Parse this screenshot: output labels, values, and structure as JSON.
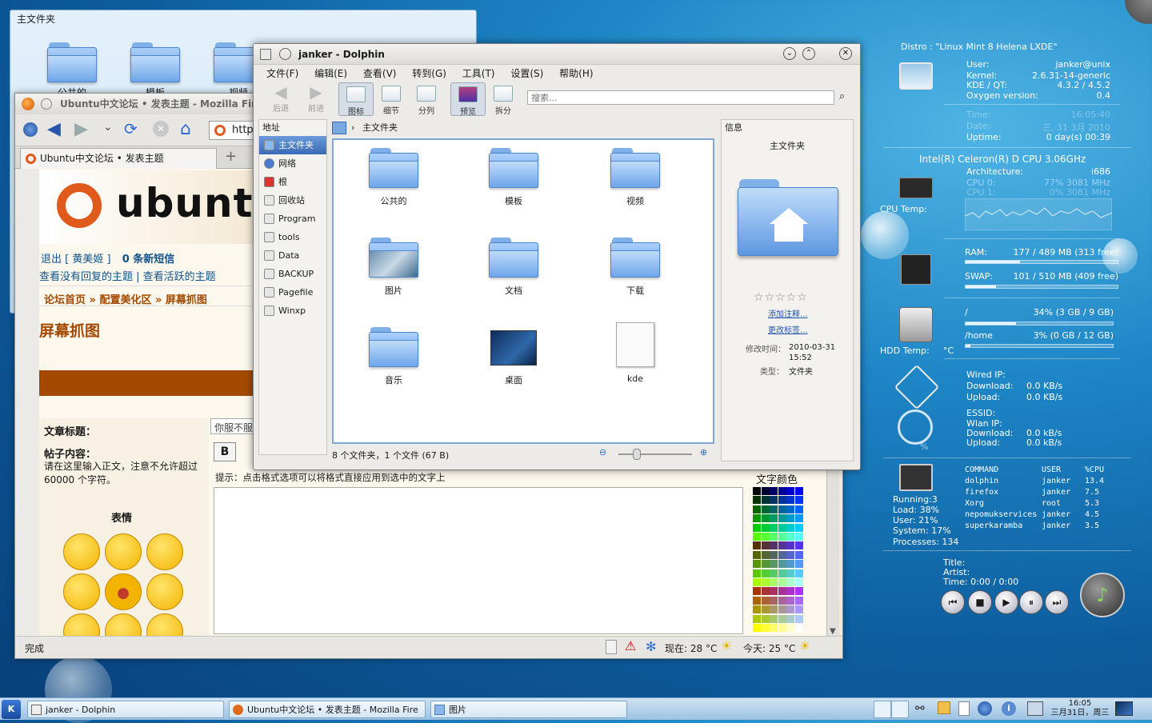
{
  "background_window": {
    "title": "主文件夹",
    "folders": [
      "公共的",
      "模板",
      "视频"
    ]
  },
  "firefox": {
    "title": "Ubuntu中文论坛 • 发表主题 - Mozilla Firefox",
    "url": "http",
    "tab_label": "Ubuntu中文论坛 • 发表主题",
    "logo_text": "ubunt",
    "logout": "退出 [ 黄美姬 ]",
    "messages": "0 条新短信",
    "links": "查看没有回复的主题 | 查看活跃的主题",
    "breadcrumb": "论坛首页 » 配置美化区 » 屏幕抓图",
    "page_heading": "屏幕抓图",
    "subject_label": "文章标题：",
    "subject_value": "你服不服",
    "content_label": "帖子内容：",
    "content_hint": "请在这里输入正文，注意不允许超过 60000 个字符。",
    "bold_btn": "B",
    "format_hint": "提示：点击格式选项可以将格式直接应用到选中的文字上",
    "text_color": "文字颜色",
    "emoticons": "表情",
    "status": "完成",
    "weather_now": "现在: 28 °C",
    "weather_today": "今天: 25 °C"
  },
  "dolphin": {
    "title": "janker - Dolphin",
    "menu": [
      "文件(F)",
      "编辑(E)",
      "查看(V)",
      "转到(G)",
      "工具(T)",
      "设置(S)",
      "帮助(H)"
    ],
    "toolbar": {
      "back": "后退",
      "forward": "前进",
      "icons": "图标",
      "details": "细节",
      "columns": "分列",
      "preview": "预览",
      "split": "拆分"
    },
    "search_placeholder": "搜索...",
    "places_title": "地址",
    "places": [
      "主文件夹",
      "网络",
      "根",
      "回收站",
      "Program",
      "tools",
      "Data",
      "BACKUP",
      "Pagefile",
      "Winxp"
    ],
    "breadcrumb": "主文件夹",
    "files": [
      "公共的",
      "模板",
      "视频",
      "图片",
      "文档",
      "下载",
      "音乐",
      "桌面",
      "kde"
    ],
    "statusbar": "8 个文件夹，1 个文件 (67 B)",
    "info": {
      "title": "信息",
      "name": "主文件夹",
      "add_comment": "添加注释...",
      "change_tags": "更改标签...",
      "modified_label": "修改时间：",
      "modified_value": "2010-03-31\n15:52",
      "type_label": "类型：",
      "type_value": "文件夹"
    }
  },
  "sysmon": {
    "distro": "Distro :  \"Linux Mint 8 Helena LXDE\"",
    "user_label": "User:",
    "user": "janker@unix",
    "kernel_label": "Kernel:",
    "kernel": "2.6.31-14-generic",
    "kde_label": "KDE / QT:",
    "kde": "4.3.2 / 4.5.2",
    "oxygen_label": "Oxygen version:",
    "oxygen": "0.4",
    "time_label": "Time:",
    "time": "16:05:40",
    "date_label": "Date:",
    "date": "三, 31  3月 2010",
    "uptime_label": "Uptime:",
    "uptime": "0 day(s)  00:39",
    "cpu_name": "Intel(R) Celeron(R) D CPU 3.06GHz",
    "arch_label": "Architecture:",
    "arch": "i686",
    "cpu0_label": "CPU 0:",
    "cpu0": "77%   3081 MHz",
    "cpu1_label": "CPU 1:",
    "cpu1": "0%   3081 MHz",
    "cpu_temp": "CPU Temp:",
    "ram_label": "RAM:",
    "ram": "177 / 489 MB (313 free)",
    "ram_frac": 0.36,
    "swap_label": "SWAP:",
    "swap": "101 / 510 MB (409 free)",
    "swap_frac": 0.2,
    "root_label": "/",
    "root": "34% (3 GB / 9 GB)",
    "root_frac": 0.34,
    "home_label": "/home",
    "home": "3% (0 GB / 12 GB)",
    "home_frac": 0.03,
    "hdd_temp": "HDD Temp:",
    "hdd_unit": "°C",
    "wired_ip": "Wired IP:",
    "download": "Download:",
    "upload": "Upload:",
    "wired_down": "0.0 KB/s",
    "wired_up": "0.0 KB/s",
    "essid": "ESSID:",
    "wlan_ip": "Wlan IP:",
    "wlan_down": "0.0 kB/s",
    "wlan_up": "0.0 kB/s",
    "wifi_pct": "%",
    "proc_headers": [
      "COMMAND",
      "USER",
      "%CPU"
    ],
    "procs": [
      [
        "dolphin",
        "janker",
        "13.4"
      ],
      [
        "firefox",
        "janker",
        "7.5"
      ],
      [
        "Xorg",
        "root",
        "5.3"
      ],
      [
        "nepomukservices",
        "janker",
        "4.5"
      ],
      [
        "superkaramba",
        "janker",
        "3.5"
      ]
    ],
    "running": "Running:3",
    "load": "Load:   38%",
    "user_pct": "User:   21%",
    "system": "System: 17%",
    "processes": "Processes: 134",
    "player_title": "Title:",
    "player_artist": "Artist:",
    "player_time": "Time: 0:00 / 0:00"
  },
  "taskbar": {
    "tasks": [
      "janker - Dolphin",
      "Ubuntu中文论坛 • 发表主题 - Mozilla Fire",
      "图片"
    ],
    "clock_time": "16:05",
    "clock_date": "三月31日，周三"
  }
}
